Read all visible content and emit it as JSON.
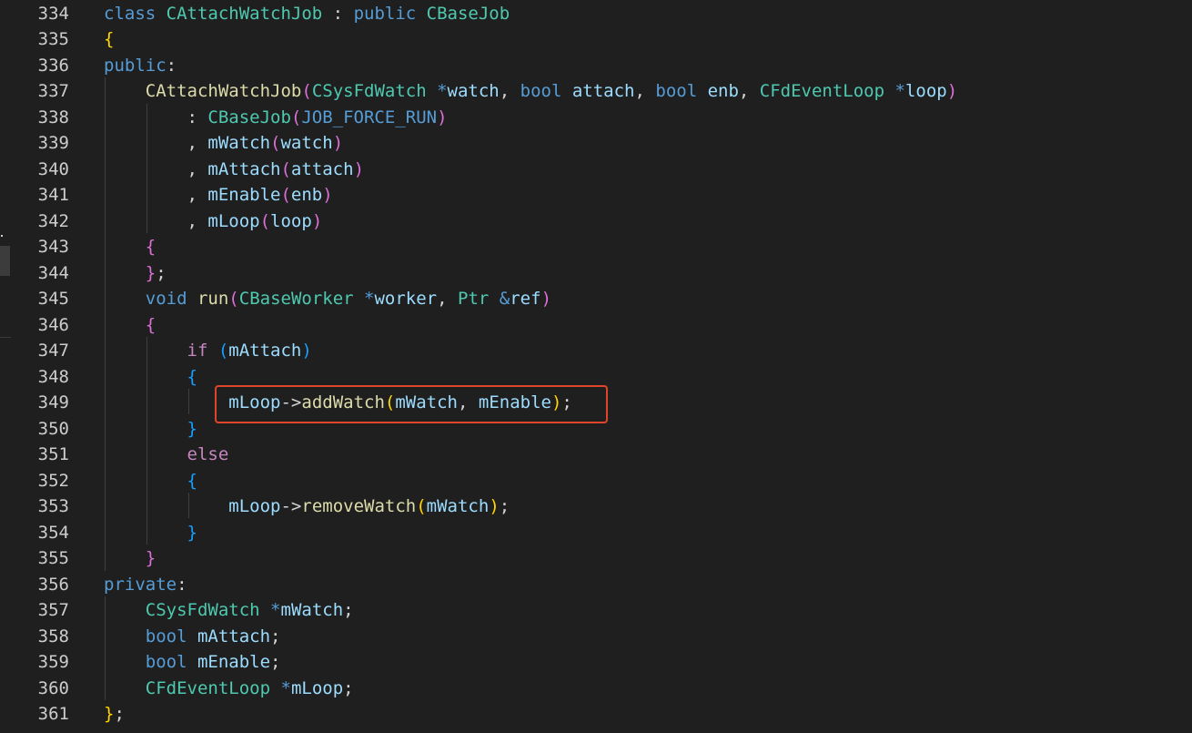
{
  "editor": {
    "line_numbers": [
      "334",
      "335",
      "336",
      "337",
      "338",
      "339",
      "340",
      "341",
      "342",
      "343",
      "344",
      "345",
      "346",
      "347",
      "348",
      "349",
      "350",
      "351",
      "352",
      "353",
      "354",
      "355",
      "356",
      "357",
      "358",
      "359",
      "360",
      "361"
    ],
    "lines": [
      [
        [
          "kw",
          "class "
        ],
        [
          "type",
          "CAttachWatchJob"
        ],
        [
          "punc",
          " : "
        ],
        [
          "kw",
          "public "
        ],
        [
          "type",
          "CBaseJob"
        ]
      ],
      [
        [
          "b1",
          "{"
        ]
      ],
      [
        [
          "kw",
          "public"
        ],
        [
          "punc",
          ":"
        ]
      ],
      [
        [
          "punc",
          "    "
        ],
        [
          "fn",
          "CAttachWatchJob"
        ],
        [
          "b2",
          "("
        ],
        [
          "type",
          "CSysFdWatch "
        ],
        [
          "kw",
          "*"
        ],
        [
          "var",
          "watch"
        ],
        [
          "punc",
          ", "
        ],
        [
          "kw",
          "bool "
        ],
        [
          "var",
          "attach"
        ],
        [
          "punc",
          ", "
        ],
        [
          "kw",
          "bool "
        ],
        [
          "var",
          "enb"
        ],
        [
          "punc",
          ", "
        ],
        [
          "type",
          "CFdEventLoop "
        ],
        [
          "kw",
          "*"
        ],
        [
          "var",
          "loop"
        ],
        [
          "b2",
          ")"
        ]
      ],
      [
        [
          "punc",
          "        : "
        ],
        [
          "type",
          "CBaseJob"
        ],
        [
          "b2",
          "("
        ],
        [
          "macro",
          "JOB_FORCE_RUN"
        ],
        [
          "b2",
          ")"
        ]
      ],
      [
        [
          "punc",
          "        , "
        ],
        [
          "var",
          "mWatch"
        ],
        [
          "b2",
          "("
        ],
        [
          "var",
          "watch"
        ],
        [
          "b2",
          ")"
        ]
      ],
      [
        [
          "punc",
          "        , "
        ],
        [
          "var",
          "mAttach"
        ],
        [
          "b2",
          "("
        ],
        [
          "var",
          "attach"
        ],
        [
          "b2",
          ")"
        ]
      ],
      [
        [
          "punc",
          "        , "
        ],
        [
          "var",
          "mEnable"
        ],
        [
          "b2",
          "("
        ],
        [
          "var",
          "enb"
        ],
        [
          "b2",
          ")"
        ]
      ],
      [
        [
          "punc",
          "        , "
        ],
        [
          "var",
          "mLoop"
        ],
        [
          "b2",
          "("
        ],
        [
          "var",
          "loop"
        ],
        [
          "b2",
          ")"
        ]
      ],
      [
        [
          "punc",
          "    "
        ],
        [
          "b2",
          "{"
        ]
      ],
      [
        [
          "punc",
          "    "
        ],
        [
          "b2",
          "}"
        ],
        [
          "punc",
          ";"
        ]
      ],
      [
        [
          "punc",
          "    "
        ],
        [
          "kw",
          "void "
        ],
        [
          "fn",
          "run"
        ],
        [
          "b2",
          "("
        ],
        [
          "type",
          "CBaseWorker "
        ],
        [
          "kw",
          "*"
        ],
        [
          "var",
          "worker"
        ],
        [
          "punc",
          ", "
        ],
        [
          "type",
          "Ptr "
        ],
        [
          "kw",
          "&"
        ],
        [
          "var",
          "ref"
        ],
        [
          "b2",
          ")"
        ]
      ],
      [
        [
          "punc",
          "    "
        ],
        [
          "b2",
          "{"
        ]
      ],
      [
        [
          "punc",
          "        "
        ],
        [
          "ctl",
          "if "
        ],
        [
          "b3",
          "("
        ],
        [
          "var",
          "mAttach"
        ],
        [
          "b3",
          ")"
        ]
      ],
      [
        [
          "punc",
          "        "
        ],
        [
          "b3",
          "{"
        ]
      ],
      [
        [
          "punc",
          "            "
        ],
        [
          "var",
          "mLoop"
        ],
        [
          "punc",
          "->"
        ],
        [
          "fn",
          "addWatch"
        ],
        [
          "b1",
          "("
        ],
        [
          "var",
          "mWatch"
        ],
        [
          "punc",
          ", "
        ],
        [
          "var",
          "mEnable"
        ],
        [
          "b1",
          ")"
        ],
        [
          "punc",
          ";"
        ]
      ],
      [
        [
          "punc",
          "        "
        ],
        [
          "b3",
          "}"
        ]
      ],
      [
        [
          "punc",
          "        "
        ],
        [
          "ctl",
          "else"
        ]
      ],
      [
        [
          "punc",
          "        "
        ],
        [
          "b3",
          "{"
        ]
      ],
      [
        [
          "punc",
          "            "
        ],
        [
          "var",
          "mLoop"
        ],
        [
          "punc",
          "->"
        ],
        [
          "fn",
          "removeWatch"
        ],
        [
          "b1",
          "("
        ],
        [
          "var",
          "mWatch"
        ],
        [
          "b1",
          ")"
        ],
        [
          "punc",
          ";"
        ]
      ],
      [
        [
          "punc",
          "        "
        ],
        [
          "b3",
          "}"
        ]
      ],
      [
        [
          "punc",
          "    "
        ],
        [
          "b2",
          "}"
        ]
      ],
      [
        [
          "kw",
          "private"
        ],
        [
          "punc",
          ":"
        ]
      ],
      [
        [
          "punc",
          "    "
        ],
        [
          "type",
          "CSysFdWatch "
        ],
        [
          "kw",
          "*"
        ],
        [
          "var",
          "mWatch"
        ],
        [
          "punc",
          ";"
        ]
      ],
      [
        [
          "punc",
          "    "
        ],
        [
          "kw",
          "bool "
        ],
        [
          "var",
          "mAttach"
        ],
        [
          "punc",
          ";"
        ]
      ],
      [
        [
          "punc",
          "    "
        ],
        [
          "kw",
          "bool "
        ],
        [
          "var",
          "mEnable"
        ],
        [
          "punc",
          ";"
        ]
      ],
      [
        [
          "punc",
          "    "
        ],
        [
          "type",
          "CFdEventLoop "
        ],
        [
          "kw",
          "*"
        ],
        [
          "var",
          "mLoop"
        ],
        [
          "punc",
          ";"
        ]
      ],
      [
        [
          "b1",
          "}"
        ],
        [
          "punc",
          ";"
        ]
      ]
    ]
  },
  "colors": {
    "background": "#1f1f1f",
    "line_number": "#cccccc",
    "keyword": "#569cd6",
    "control": "#c586c0",
    "type": "#4ec9b0",
    "function": "#dcdcaa",
    "variable": "#9cdcfe",
    "highlight_border": "#e0442a"
  }
}
